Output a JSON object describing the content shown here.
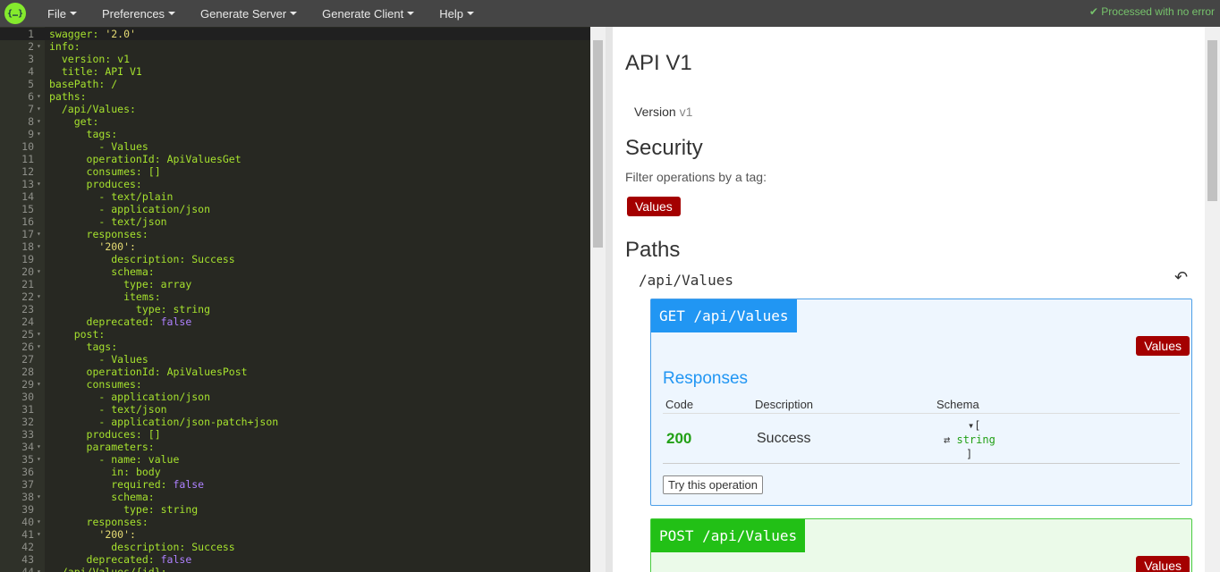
{
  "menu": {
    "items": [
      "File",
      "Preferences",
      "Generate Server",
      "Generate Client",
      "Help"
    ],
    "status": "✔ Processed with no error"
  },
  "editor": {
    "lines": [
      [
        "swagger: ",
        "'2.0'"
      ],
      [
        "info:",
        ""
      ],
      [
        "  version: ",
        "v1"
      ],
      [
        "  title: ",
        "API V1"
      ],
      [
        "basePath: ",
        "/"
      ],
      [
        "paths:",
        ""
      ],
      [
        "  /api/Values:",
        ""
      ],
      [
        "    get:",
        ""
      ],
      [
        "      tags:",
        ""
      ],
      [
        "        - ",
        "Values"
      ],
      [
        "      operationId: ",
        "ApiValuesGet"
      ],
      [
        "      consumes: ",
        "[]"
      ],
      [
        "      produces:",
        ""
      ],
      [
        "        - ",
        "text/plain"
      ],
      [
        "        - ",
        "application/json"
      ],
      [
        "        - ",
        "text/json"
      ],
      [
        "      responses:",
        ""
      ],
      [
        "        ",
        "'200':"
      ],
      [
        "          description: ",
        "Success"
      ],
      [
        "          schema:",
        ""
      ],
      [
        "            type: ",
        "array"
      ],
      [
        "            items:",
        ""
      ],
      [
        "              type: ",
        "string"
      ],
      [
        "      deprecated: ",
        "false"
      ],
      [
        "    post:",
        ""
      ],
      [
        "      tags:",
        ""
      ],
      [
        "        - ",
        "Values"
      ],
      [
        "      operationId: ",
        "ApiValuesPost"
      ],
      [
        "      consumes:",
        ""
      ],
      [
        "        - ",
        "application/json"
      ],
      [
        "        - ",
        "text/json"
      ],
      [
        "        - ",
        "application/json-patch+json"
      ],
      [
        "      produces: ",
        "[]"
      ],
      [
        "      parameters:",
        ""
      ],
      [
        "        - name: ",
        "value"
      ],
      [
        "          in: ",
        "body"
      ],
      [
        "          required: ",
        "false"
      ],
      [
        "          schema:",
        ""
      ],
      [
        "            type: ",
        "string"
      ],
      [
        "      responses:",
        ""
      ],
      [
        "        ",
        "'200':"
      ],
      [
        "          description: ",
        "Success"
      ],
      [
        "      deprecated: ",
        "false"
      ],
      [
        "  /api/Values/{id}:",
        ""
      ]
    ]
  },
  "preview": {
    "title": "API V1",
    "version_label": "Version",
    "version_value": "v1",
    "security_heading": "Security",
    "filter_text": "Filter operations by a tag:",
    "tag": "Values",
    "paths_heading": "Paths",
    "path_name": "/api/Values",
    "get": {
      "header": "GET /api/Values",
      "tag": "Values",
      "responses_title": "Responses",
      "columns": [
        "Code",
        "Description",
        "Schema"
      ],
      "code": "200",
      "description": "Success",
      "schema_open": "[",
      "schema_item": "string",
      "schema_close": "]",
      "try_label": "Try this operation"
    },
    "post": {
      "header": "POST /api/Values",
      "tag": "Values"
    }
  }
}
